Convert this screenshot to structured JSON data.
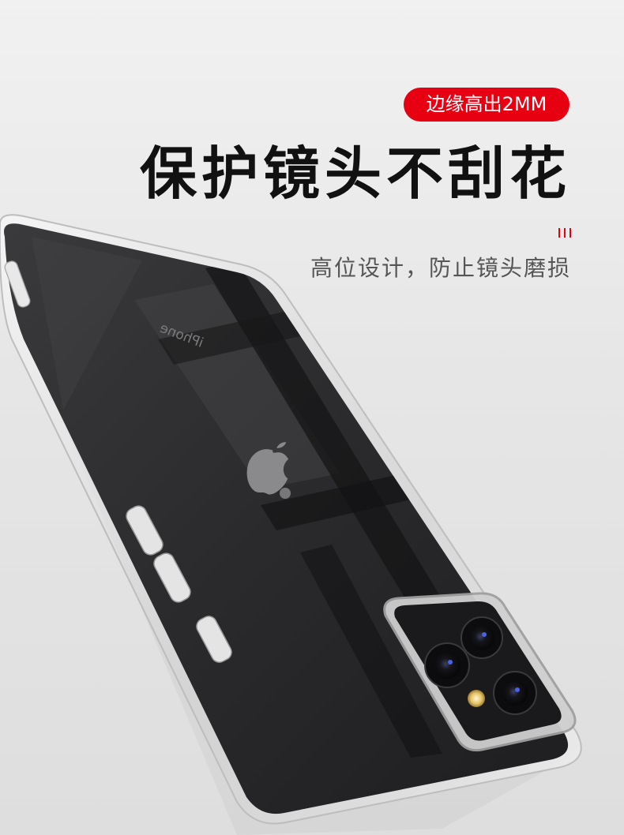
{
  "badge": {
    "label": "边缘高出2MM"
  },
  "headline": {
    "title": "保护镜头不刮花"
  },
  "subheading": {
    "text": "高位设计，防止镜头磨损"
  },
  "product_image": {
    "brand_mark": "iPhone"
  },
  "colors": {
    "accent": "#e60012",
    "background": "#ececec",
    "title": "#111111",
    "subtitle": "#555555",
    "phone_body": "#2b2b2d"
  }
}
